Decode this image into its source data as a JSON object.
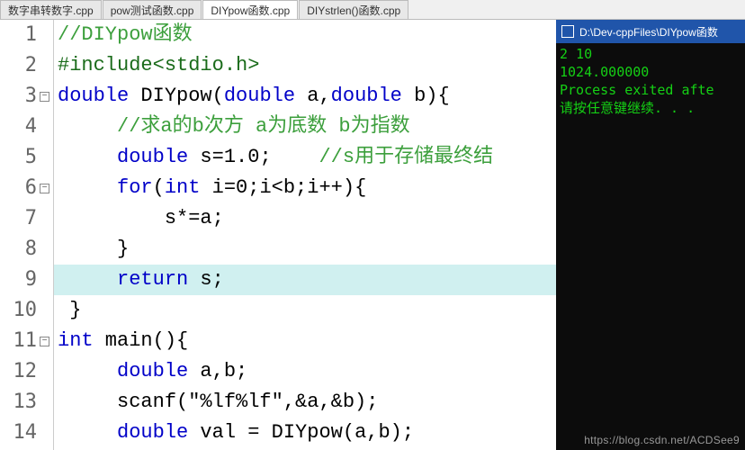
{
  "tabs": [
    {
      "label": "数字串转数字.cpp",
      "active": false
    },
    {
      "label": "pow测试函数.cpp",
      "active": false
    },
    {
      "label": "DIYpow函数.cpp",
      "active": true
    },
    {
      "label": "DIYstrlen()函数.cpp",
      "active": false
    }
  ],
  "lines": [
    {
      "n": "1",
      "fold": "",
      "hl": false,
      "tokens": [
        {
          "c": "c-comment",
          "t": "//DIYpow函数"
        }
      ]
    },
    {
      "n": "2",
      "fold": "",
      "hl": false,
      "tokens": [
        {
          "c": "c-prep",
          "t": "#include<stdio.h>"
        }
      ]
    },
    {
      "n": "3",
      "fold": "-",
      "hl": false,
      "tokens": [
        {
          "c": "c-keyword",
          "t": "double"
        },
        {
          "c": "c-text",
          "t": " DIYpow("
        },
        {
          "c": "c-keyword",
          "t": "double"
        },
        {
          "c": "c-text",
          "t": " a,"
        },
        {
          "c": "c-keyword",
          "t": "double"
        },
        {
          "c": "c-text",
          "t": " b){"
        }
      ]
    },
    {
      "n": "4",
      "fold": "",
      "hl": false,
      "tokens": [
        {
          "c": "c-text",
          "t": "     "
        },
        {
          "c": "c-comment",
          "t": "//求a的b次方 a为底数 b为指数"
        }
      ]
    },
    {
      "n": "5",
      "fold": "",
      "hl": false,
      "tokens": [
        {
          "c": "c-text",
          "t": "     "
        },
        {
          "c": "c-keyword",
          "t": "double"
        },
        {
          "c": "c-text",
          "t": " s=1.0;    "
        },
        {
          "c": "c-comment",
          "t": "//s用于存储最终结"
        }
      ]
    },
    {
      "n": "6",
      "fold": "-",
      "hl": false,
      "tokens": [
        {
          "c": "c-text",
          "t": "     "
        },
        {
          "c": "c-keyword",
          "t": "for"
        },
        {
          "c": "c-text",
          "t": "("
        },
        {
          "c": "c-keyword",
          "t": "int"
        },
        {
          "c": "c-text",
          "t": " i=0;i<b;i++){"
        }
      ]
    },
    {
      "n": "7",
      "fold": "",
      "hl": false,
      "tokens": [
        {
          "c": "c-text",
          "t": "         s*=a;"
        }
      ]
    },
    {
      "n": "8",
      "fold": "",
      "hl": false,
      "tokens": [
        {
          "c": "c-text",
          "t": "     }"
        }
      ]
    },
    {
      "n": "9",
      "fold": "",
      "hl": true,
      "tokens": [
        {
          "c": "c-text",
          "t": "     "
        },
        {
          "c": "c-keyword",
          "t": "return"
        },
        {
          "c": "c-text",
          "t": " s;"
        }
      ]
    },
    {
      "n": "10",
      "fold": "",
      "hl": false,
      "tokens": [
        {
          "c": "c-text",
          "t": " }"
        }
      ]
    },
    {
      "n": "11",
      "fold": "-",
      "hl": false,
      "tokens": [
        {
          "c": "c-keyword",
          "t": "int"
        },
        {
          "c": "c-text",
          "t": " main(){"
        }
      ]
    },
    {
      "n": "12",
      "fold": "",
      "hl": false,
      "tokens": [
        {
          "c": "c-text",
          "t": "     "
        },
        {
          "c": "c-keyword",
          "t": "double"
        },
        {
          "c": "c-text",
          "t": " a,b;"
        }
      ]
    },
    {
      "n": "13",
      "fold": "",
      "hl": false,
      "tokens": [
        {
          "c": "c-text",
          "t": "     scanf(\"%lf%lf\",&a,&b);"
        }
      ]
    },
    {
      "n": "14",
      "fold": "",
      "hl": false,
      "tokens": [
        {
          "c": "c-text",
          "t": "     "
        },
        {
          "c": "c-keyword",
          "t": "double"
        },
        {
          "c": "c-text",
          "t": " val = DIYpow(a,b);"
        }
      ]
    }
  ],
  "console": {
    "title": "D:\\Dev-cppFiles\\DIYpow函数",
    "lines": [
      "2 10",
      "1024.000000",
      "",
      "Process exited afte",
      "请按任意键继续. . ."
    ]
  },
  "watermark": "https://blog.csdn.net/ACDSee9"
}
